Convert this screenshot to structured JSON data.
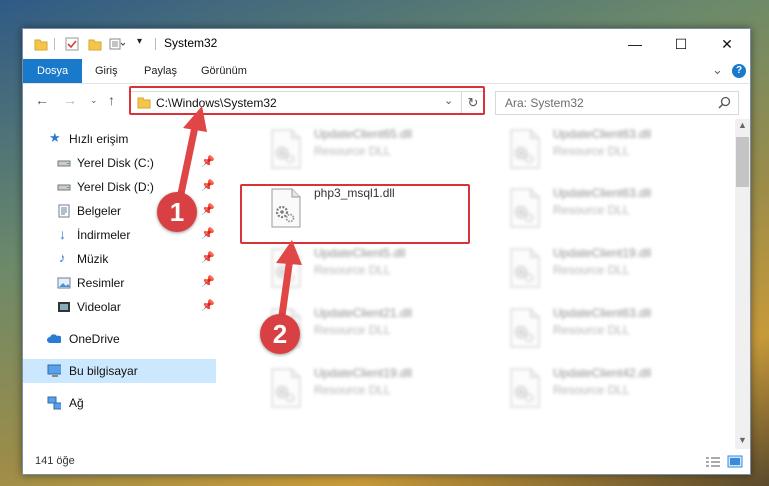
{
  "window": {
    "title": "System32",
    "minimize": "—",
    "maximize": "☐",
    "close": "✕"
  },
  "ribbon": {
    "tabs": [
      {
        "label": "Dosya"
      },
      {
        "label": "Giriş"
      },
      {
        "label": "Paylaş"
      },
      {
        "label": "Görünüm"
      }
    ],
    "expand": "⌄",
    "help": "?"
  },
  "address": {
    "path": "C:\\Windows\\System32",
    "search_placeholder": "Ara: System32"
  },
  "nav": {
    "quick_access": "Hızlı erişim",
    "items": [
      {
        "label": "Yerel Disk (C:)"
      },
      {
        "label": "Yerel Disk (D:)"
      },
      {
        "label": "Belgeler"
      },
      {
        "label": "İndirmeler"
      },
      {
        "label": "Müzik"
      },
      {
        "label": "Resimler"
      },
      {
        "label": "Videolar"
      }
    ],
    "onedrive": "OneDrive",
    "this_pc": "Bu bilgisayar",
    "network": "Ağ"
  },
  "files": [
    {
      "name": "UpdateClient65.dll",
      "type": "Resource DLL"
    },
    {
      "name": "UpdateClient63.dll",
      "type": "Resource DLL"
    },
    {
      "name": "php3_msql1.dll",
      "type": ""
    },
    {
      "name": "UpdateClient63.dll",
      "type": "Resource DLL"
    },
    {
      "name": "UpdateClient5.dll",
      "type": "Resource DLL"
    },
    {
      "name": "UpdateClient19.dll",
      "type": "Resource DLL"
    },
    {
      "name": "UpdateClient21.dll",
      "type": "Resource DLL"
    },
    {
      "name": "UpdateClient63.dll",
      "type": "Resource DLL"
    },
    {
      "name": "UpdateClient19.dll",
      "type": "Resource DLL"
    },
    {
      "name": "UpdateClient42.dll",
      "type": "Resource DLL"
    }
  ],
  "status": {
    "count": "141 öğe"
  },
  "annotations": {
    "step1": "1",
    "step2": "2",
    "color": "#d9323a"
  }
}
